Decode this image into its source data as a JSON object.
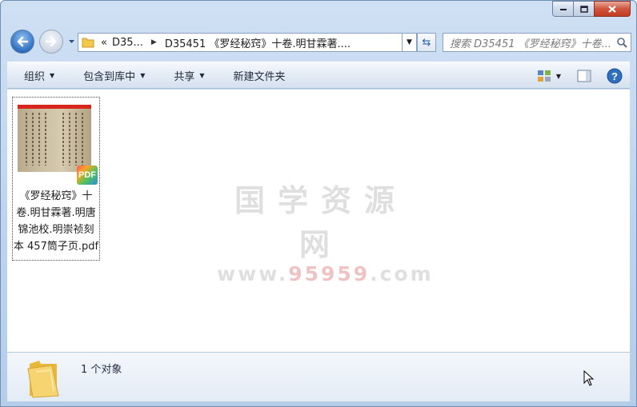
{
  "window": {
    "caption_buttons": [
      "minimize",
      "maximize",
      "close"
    ]
  },
  "nav": {
    "breadcrumb_overflow": "«",
    "breadcrumb_root": "D35...",
    "breadcrumb_current": "D35451 《罗经秘窍》十卷.明甘霖著....",
    "search_placeholder": "搜索 D35451 《罗经秘窍》十卷..."
  },
  "toolbar": {
    "organize": "组织",
    "include_library": "包含到库中",
    "share": "共享",
    "new_folder": "新建文件夹"
  },
  "files": [
    {
      "name": "《罗经秘窍》十卷.明甘霖著.明唐锦池校.明崇祯刻本 457筒子页.pdf",
      "badge": "PDF",
      "thumb_header": "PDF"
    }
  ],
  "watermark": {
    "line1": "国学资源网",
    "line2_prefix": "www.",
    "line2_red": "95959",
    "line2_suffix": ".com"
  },
  "details": {
    "count_text": "1 个对象"
  },
  "colors": {
    "accent": "#2f6fc0",
    "close": "#c23a22",
    "folder": "#f2c94c"
  }
}
